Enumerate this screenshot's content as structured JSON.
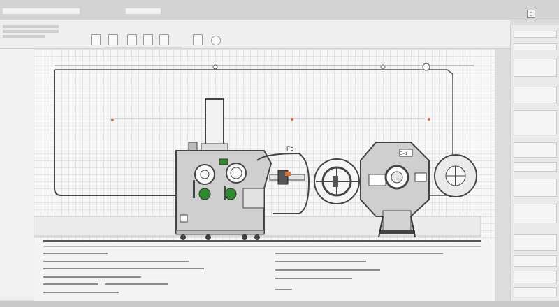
{
  "window": {
    "control_glyph": "▯",
    "control_icon": "restore-icon"
  },
  "drawing": {
    "machine_label_a": "Fc",
    "plate_label": "E=1"
  },
  "colors": {
    "accent_green": "#2e8b2e",
    "marker_red": "#d9713b",
    "line_dark": "#444444"
  },
  "toolbar": {
    "tools": [
      "pan-tool-icon",
      "select-tool-icon",
      "layer-tool-icon",
      "component-tool-icon",
      "move-tool-icon",
      "part-tool-icon",
      "circle-tool-icon"
    ]
  }
}
